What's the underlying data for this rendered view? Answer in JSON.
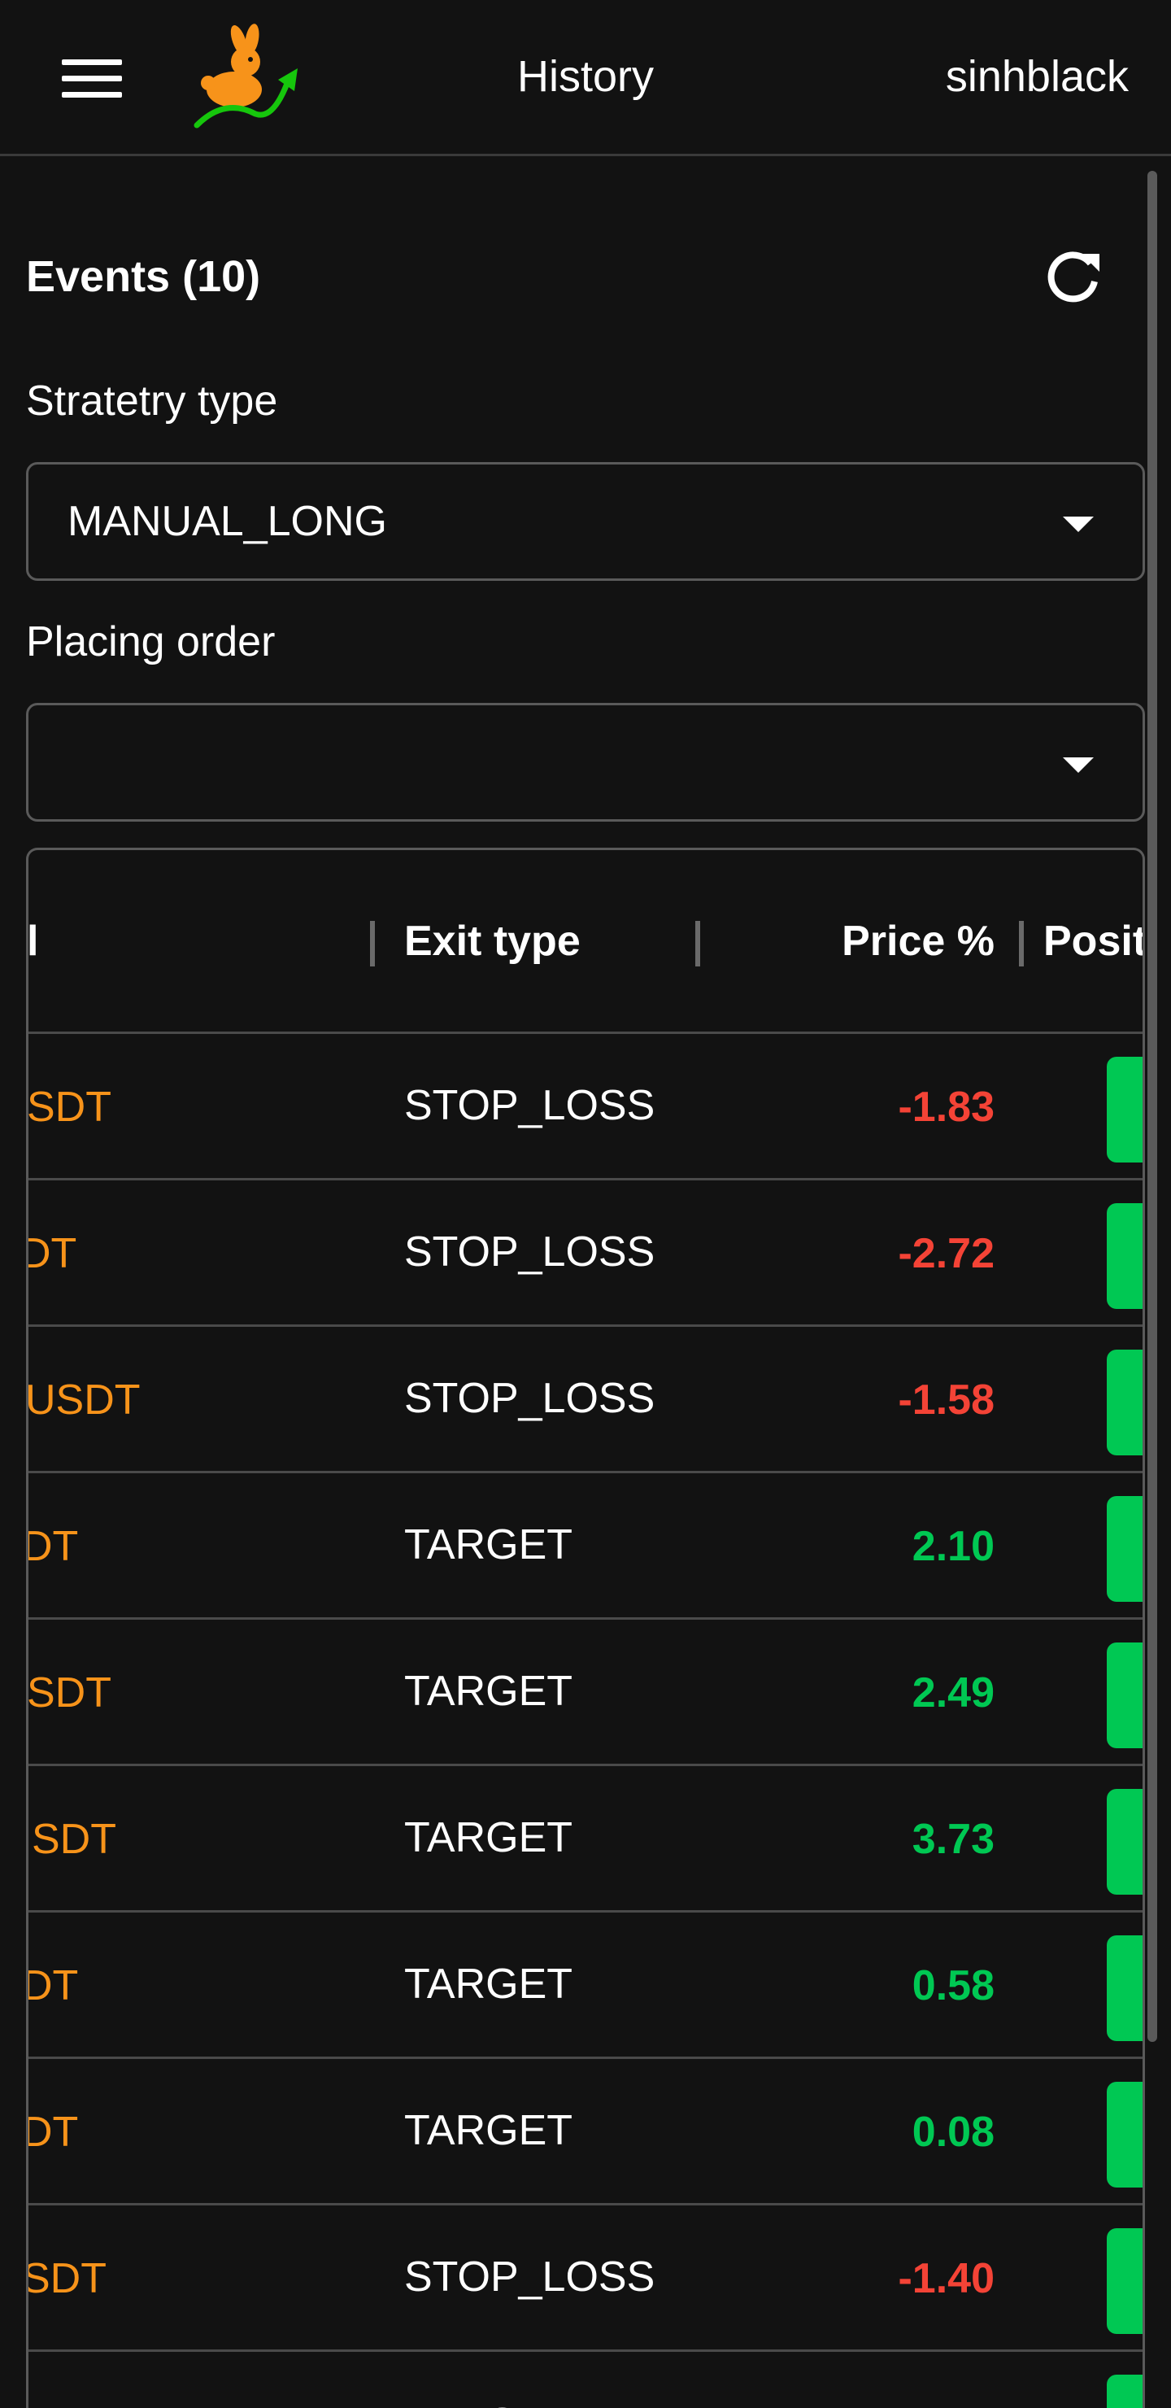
{
  "header": {
    "title": "History",
    "username": "sinhblack",
    "menu_icon": "hamburger-menu-icon",
    "logo_icon": "rabbit-logo-icon"
  },
  "events": {
    "title": "Events (10)",
    "refresh_icon": "refresh-icon"
  },
  "filters": {
    "strategy": {
      "label": "Stratetry type",
      "value": "MANUAL_LONG"
    },
    "placing_order": {
      "label": "Placing order",
      "value": ""
    }
  },
  "colors": {
    "background": "#121212",
    "accent_orange": "#f7931a",
    "negative_red": "#f44336",
    "positive_green": "#00c853"
  },
  "table": {
    "columns": {
      "symbol": "l",
      "exit_type": "Exit type",
      "price_pct": "Price %",
      "position": "Posit"
    },
    "rows": [
      {
        "symbol": "SDT",
        "exit_type": "STOP_LOSS",
        "price_pct": "-1.83",
        "trend": "negative"
      },
      {
        "symbol": "DT",
        "exit_type": "STOP_LOSS",
        "price_pct": "-2.72",
        "trend": "negative"
      },
      {
        "symbol": "USDT",
        "exit_type": "STOP_LOSS",
        "price_pct": "-1.58",
        "trend": "negative"
      },
      {
        "symbol": "DT",
        "exit_type": "TARGET",
        "price_pct": "2.10",
        "trend": "positive"
      },
      {
        "symbol": "SDT",
        "exit_type": "TARGET",
        "price_pct": "2.49",
        "trend": "positive"
      },
      {
        "symbol": "SDT",
        "exit_type": "TARGET",
        "price_pct": "3.73",
        "trend": "positive"
      },
      {
        "symbol": "DT",
        "exit_type": "TARGET",
        "price_pct": "0.58",
        "trend": "positive"
      },
      {
        "symbol": "DT",
        "exit_type": "TARGET",
        "price_pct": "0.08",
        "trend": "positive"
      },
      {
        "symbol": "SDT",
        "exit_type": "STOP_LOSS",
        "price_pct": "-1.40",
        "trend": "negative"
      },
      {
        "symbol": "",
        "exit_type": "TARGET",
        "price_pct": "",
        "trend": "positive"
      }
    ]
  }
}
